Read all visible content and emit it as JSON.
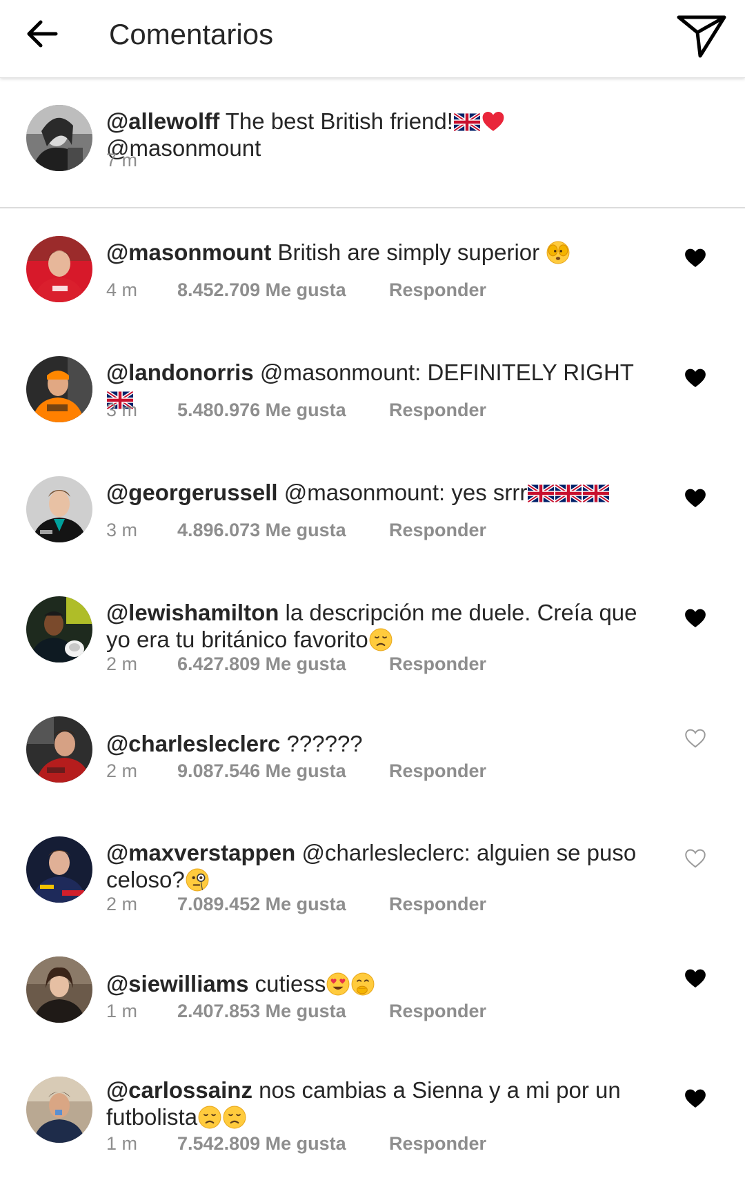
{
  "header": {
    "title": "Comentarios",
    "back_icon": "arrow-left-icon",
    "share_icon": "paper-plane-icon"
  },
  "caption": {
    "username": "@allewolff",
    "text": " The best British friend!",
    "mention": " @masonmount",
    "time": "7 m"
  },
  "reply_label": "Responder",
  "colors": {
    "text": "#262626",
    "meta": "#8e8e8e",
    "heart": "#000000",
    "divider": "#dcdcdc"
  },
  "comments": [
    {
      "username": "@masonmount",
      "text": " British are simply superior",
      "time": "4 m",
      "likes": "8.452.709 Me gusta",
      "liked": true
    },
    {
      "username": "@landonorris",
      "text": " @masonmount: DEFINITELY RIGHT",
      "time": "3 m",
      "likes": "5.480.976 Me gusta",
      "liked": true
    },
    {
      "username": "@georgerussell",
      "text": " @masonmount: yes srrr",
      "time": "3 m",
      "likes": "4.896.073 Me gusta",
      "liked": true
    },
    {
      "username": "@lewishamilton",
      "text": " la descripción me duele. Creía que yo era tu británico favorito",
      "time": "2 m",
      "likes": "6.427.809 Me gusta",
      "liked": true
    },
    {
      "username": "@charlesleclerc",
      "text": " ??????",
      "time": "2 m",
      "likes": "9.087.546 Me gusta",
      "liked": false
    },
    {
      "username": "@maxverstappen",
      "text": " @charlesleclerc: alguien se puso celoso?",
      "time": "2 m",
      "likes": "7.089.452 Me gusta",
      "liked": false
    },
    {
      "username": "@siewilliams",
      "text": " cutiess",
      "time": "1 m",
      "likes": "2.407.853 Me gusta",
      "liked": true
    },
    {
      "username": "@carlossainz",
      "text": " nos cambias a Sienna y a mi por un futbolista",
      "time": "1 m",
      "likes": "7.542.809 Me gusta",
      "liked": true
    }
  ]
}
